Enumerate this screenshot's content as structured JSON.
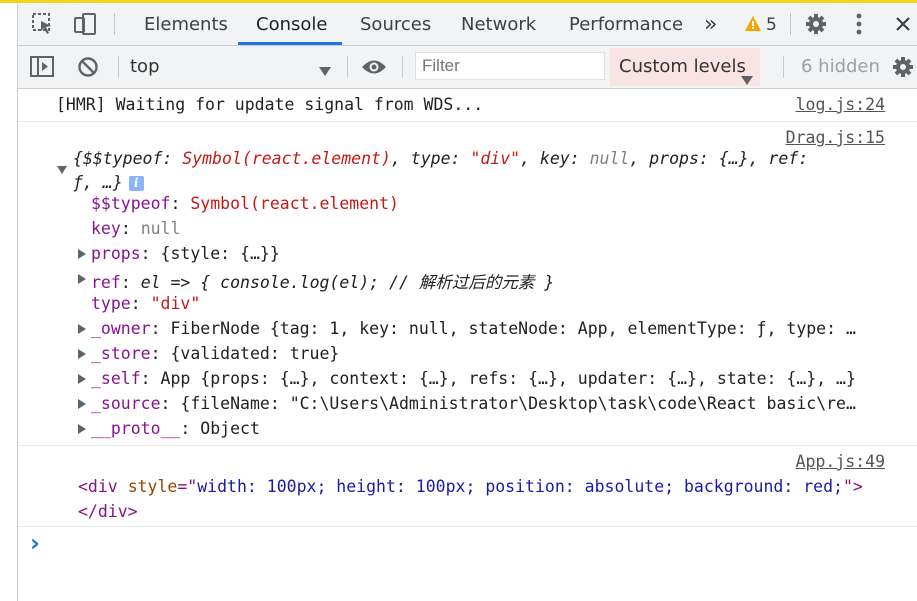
{
  "tabs": {
    "elements": "Elements",
    "console": "Console",
    "sources": "Sources",
    "network": "Network",
    "performance": "Performance",
    "more": "»",
    "warning_count": "5"
  },
  "toolbar": {
    "context": "top",
    "filter_placeholder": "Filter",
    "levels": "Custom levels",
    "hidden": "6 hidden"
  },
  "console": {
    "msg1": {
      "text": "[HMR] Waiting for update signal from WDS...",
      "source": "log.js:24"
    },
    "msg2": {
      "source": "Drag.js:15",
      "summary_a": "{$$typeof: ",
      "summary_b": "Symbol(react.element)",
      "summary_c": ", type: ",
      "summary_d": "\"div\"",
      "summary_e": ", key: ",
      "summary_f": "null",
      "summary_g": ", props: {…}, ref:",
      "summary_line2": "ƒ, …}",
      "info": "i",
      "props": [
        {
          "key": "$$typeof",
          "value": "Symbol(react.element)"
        },
        {
          "key": "key",
          "value": "null"
        },
        {
          "key": "props",
          "value": "{style: {…}}"
        },
        {
          "key": "ref",
          "value": "el => { console.log(el); // 解析过后的元素 }"
        },
        {
          "key": "type",
          "value": "\"div\""
        },
        {
          "key": "_owner",
          "value": "FiberNode {tag: 1, key: null, stateNode: App, elementType: ƒ, type: …"
        },
        {
          "key": "_store",
          "value": "{validated: true}"
        },
        {
          "key": "_self",
          "value": "App {props: {…}, context: {…}, refs: {…}, updater: {…}, state: {…}, …}"
        },
        {
          "key": "_source",
          "value": "{fileName: \"C:\\Users\\Administrator\\Desktop\\task\\code\\React basic\\re…"
        },
        {
          "key": "__proto__",
          "value": "Object"
        }
      ]
    },
    "msg3": {
      "source": "App.js:49",
      "tag_open": "<div",
      "attr_name": "style",
      "attr_eq": "=\"",
      "attr_value": "width: 100px; height: 100px; position: absolute; background: red;",
      "attr_close": "\">",
      "tag_close": "</div>"
    },
    "prompt": "›"
  }
}
